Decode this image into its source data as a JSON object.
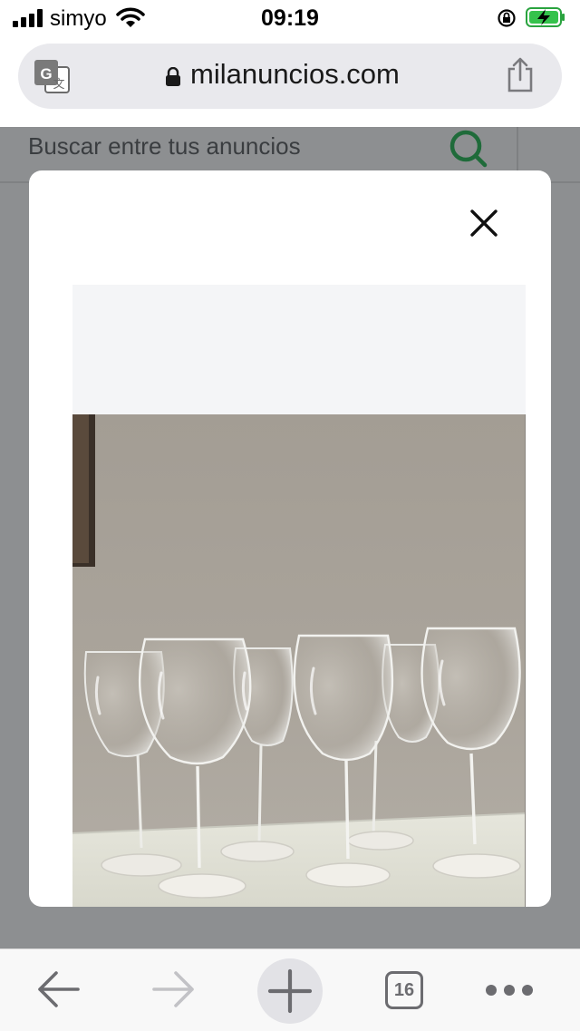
{
  "status_bar": {
    "carrier": "simyo",
    "time": "09:19"
  },
  "browser": {
    "url": "milanuncios.com",
    "tabs_count": "16"
  },
  "page": {
    "search_placeholder": "Buscar entre tus anuncios",
    "accent_color": "#1f6b3a"
  },
  "modal": {
    "photo_subject": "wine glasses on a white table"
  },
  "icons": {
    "address_bar": [
      "translate-icon",
      "lock-icon",
      "share-icon"
    ],
    "toolbar": [
      "back-arrow-icon",
      "forward-arrow-icon",
      "plus-icon",
      "tabs-icon",
      "more-icon"
    ],
    "modal": [
      "close-icon"
    ]
  }
}
